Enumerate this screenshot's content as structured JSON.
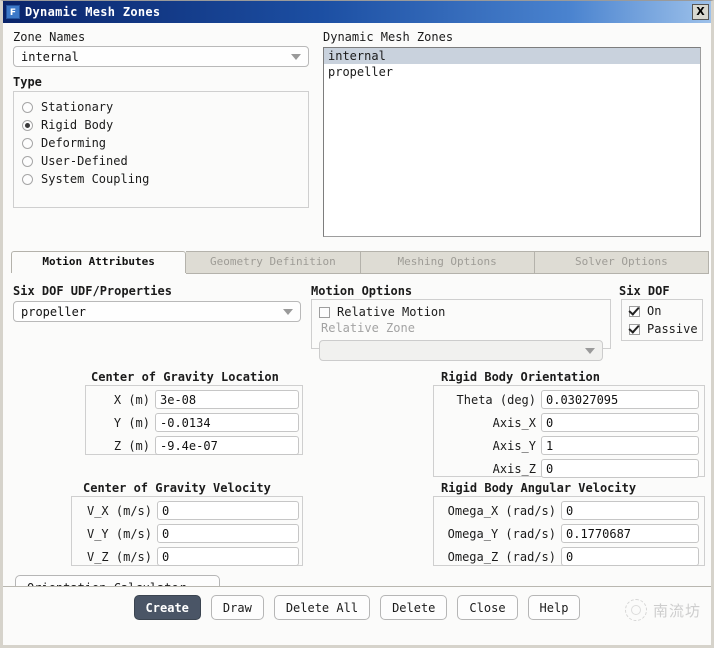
{
  "window": {
    "title": "Dynamic Mesh Zones",
    "icon": "fluent-f-icon",
    "close_label": "X"
  },
  "zone_names": {
    "label": "Zone Names",
    "value": "internal"
  },
  "zones_list": {
    "label": "Dynamic Mesh Zones",
    "items": [
      {
        "label": "internal",
        "selected": true
      },
      {
        "label": "propeller",
        "selected": false
      }
    ]
  },
  "type": {
    "label": "Type",
    "options": [
      {
        "label": "Stationary",
        "selected": false
      },
      {
        "label": "Rigid Body",
        "selected": true
      },
      {
        "label": "Deforming",
        "selected": false
      },
      {
        "label": "User-Defined",
        "selected": false
      },
      {
        "label": "System Coupling",
        "selected": false
      }
    ]
  },
  "tabs": [
    {
      "label": "Motion Attributes",
      "active": true
    },
    {
      "label": "Geometry Definition",
      "active": false
    },
    {
      "label": "Meshing Options",
      "active": false
    },
    {
      "label": "Solver Options",
      "active": false
    }
  ],
  "six_dof_udf": {
    "label": "Six DOF UDF/Properties",
    "value": "propeller"
  },
  "motion_options": {
    "label": "Motion Options",
    "relative_motion_label": "Relative Motion",
    "relative_motion_checked": false,
    "relative_zone_label": "Relative Zone",
    "relative_zone_value": ""
  },
  "six_dof": {
    "label": "Six DOF",
    "on_label": "On",
    "on_checked": true,
    "passive_label": "Passive",
    "passive_checked": true
  },
  "cg_location": {
    "label": "Center of Gravity Location",
    "rows": [
      {
        "label": "X (m)",
        "value": "3e-08"
      },
      {
        "label": "Y (m)",
        "value": "-0.0134"
      },
      {
        "label": "Z (m)",
        "value": "-9.4e-07"
      }
    ]
  },
  "orientation": {
    "label": "Rigid Body Orientation",
    "rows": [
      {
        "label": "Theta (deg)",
        "value": "0.03027095"
      },
      {
        "label": "Axis_X",
        "value": "0"
      },
      {
        "label": "Axis_Y",
        "value": "1"
      },
      {
        "label": "Axis_Z",
        "value": "0"
      }
    ]
  },
  "cg_velocity": {
    "label": "Center of Gravity Velocity",
    "rows": [
      {
        "label": "V_X (m/s)",
        "value": "0"
      },
      {
        "label": "V_Y (m/s)",
        "value": "0"
      },
      {
        "label": "V_Z (m/s)",
        "value": "0"
      }
    ]
  },
  "angular_velocity": {
    "label": "Rigid Body Angular Velocity",
    "rows": [
      {
        "label": "Omega_X (rad/s)",
        "value": "0"
      },
      {
        "label": "Omega_Y (rad/s)",
        "value": "0.1770687"
      },
      {
        "label": "Omega_Z (rad/s)",
        "value": "0"
      }
    ]
  },
  "orientation_calculator": {
    "label": "Orientation Calculator..."
  },
  "buttons": [
    {
      "label": "Create",
      "primary": true
    },
    {
      "label": "Draw",
      "primary": false
    },
    {
      "label": "Delete All",
      "primary": false
    },
    {
      "label": "Delete",
      "primary": false
    },
    {
      "label": "Close",
      "primary": false
    },
    {
      "label": "Help",
      "primary": false
    }
  ],
  "watermark": {
    "text": "南流坊"
  },
  "colors": {
    "titlebar_start": "#0a246a",
    "titlebar_end": "#9dc1ea",
    "primary_button": "#4a5566",
    "list_selection": "#c9d2dd",
    "dialog_bg": "#fbfbfa"
  }
}
